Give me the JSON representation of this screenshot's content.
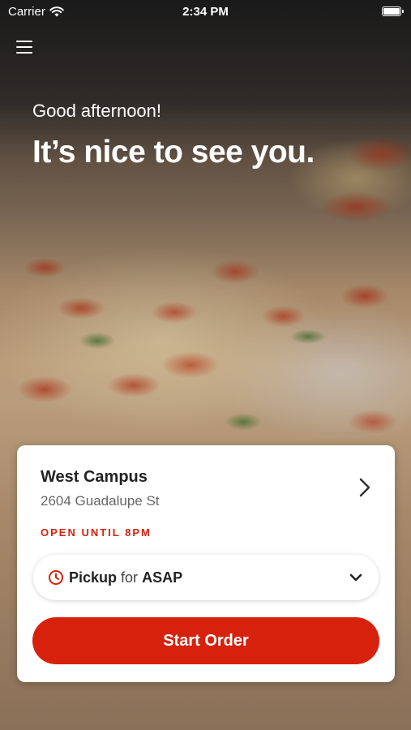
{
  "status_bar": {
    "carrier": "Carrier",
    "time": "2:34 PM",
    "wifi_icon": "wifi-icon",
    "battery_icon": "battery-icon"
  },
  "header": {
    "menu_icon": "hamburger-menu-icon",
    "greeting": "Good afternoon!",
    "headline": "It’s nice to see you."
  },
  "store_card": {
    "store_name": "West Campus",
    "address": "2604 Guadalupe St",
    "hours_status": "OPEN UNTIL 8PM",
    "order_type": "Pickup",
    "connector": "for",
    "time_option": "ASAP",
    "start_button": "Start Order"
  },
  "colors": {
    "accent": "#d6220c",
    "card_bg": "#ffffff",
    "text_dark": "#222222",
    "text_muted": "#666666"
  }
}
